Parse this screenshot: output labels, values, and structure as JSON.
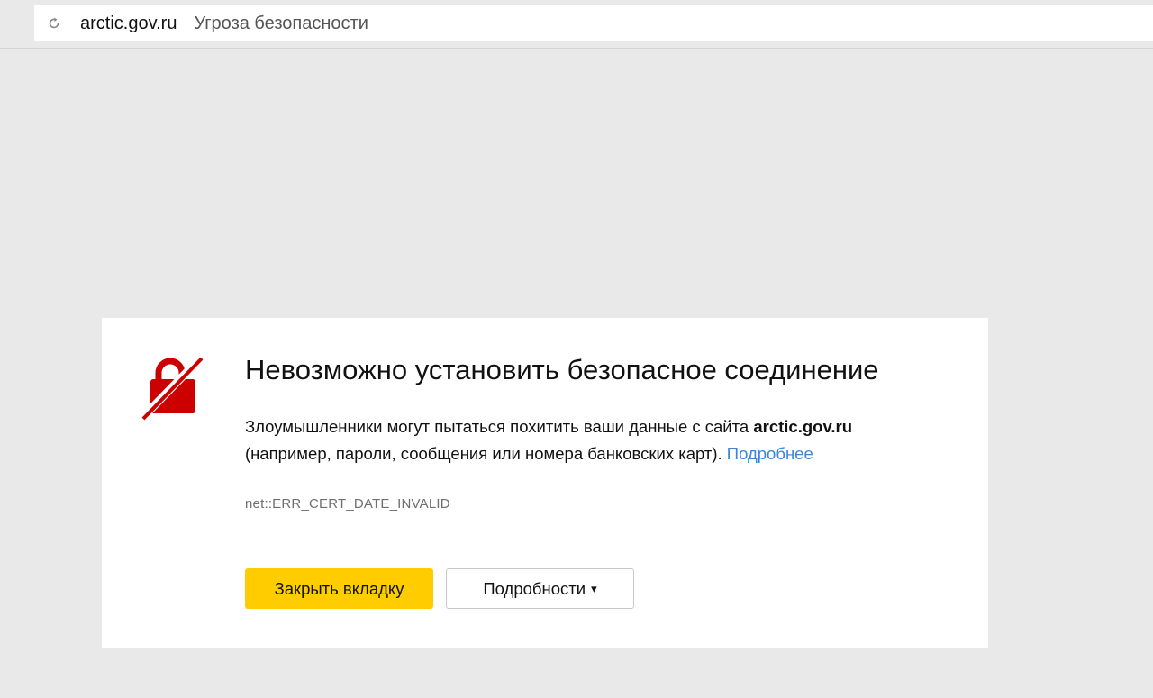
{
  "browser": {
    "domain": "arctic.gov.ru",
    "security_label": "Угроза безопасности",
    "reload_icon": "reload-icon"
  },
  "error": {
    "icon": "broken-lock-icon",
    "icon_color": "#cc0000",
    "title": "Невозможно установить безопасное соединение",
    "desc_part1": "Злоумышленники могут пытаться похитить ваши данные с сайта ",
    "desc_site": "arctic.gov.ru",
    "desc_part2": "(например, пароли, сообщения или номера банковских карт). ",
    "more_link": "Подробнее",
    "link_color": "#3b86d8",
    "code": "net::ERR_CERT_DATE_INVALID"
  },
  "actions": {
    "close_label": "Закрыть вкладку",
    "close_color": "#ffcc00",
    "details_label": "Подробности",
    "details_caret": "▾"
  }
}
